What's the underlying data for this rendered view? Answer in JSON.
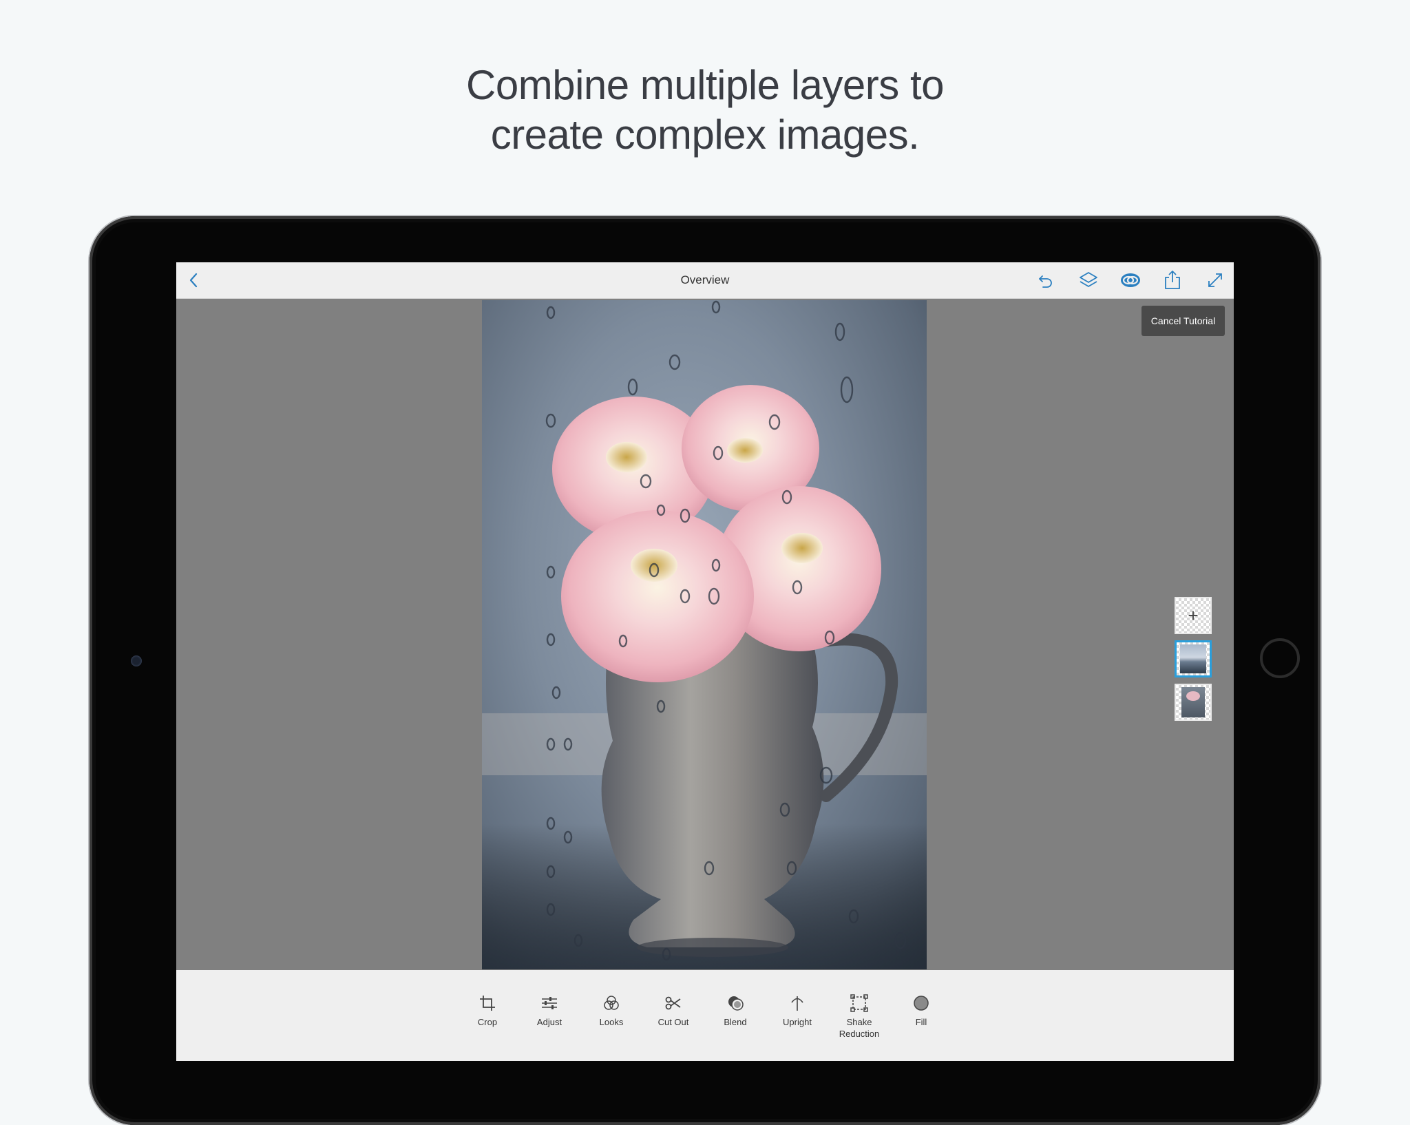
{
  "headline": {
    "line1": "Combine multiple layers to",
    "line2": "create complex images."
  },
  "app": {
    "title": "Overview",
    "cancel_tutorial": "Cancel Tutorial",
    "top_icons": [
      "back-icon",
      "undo-icon",
      "layers-icon",
      "creative-cloud-icon",
      "share-icon",
      "fullscreen-icon"
    ],
    "accent_color": "#2a9fdc"
  },
  "layers": {
    "add_symbol": "+",
    "items": [
      "Layer 1",
      "Layer 2"
    ],
    "selected_index": 0
  },
  "tools": [
    {
      "label": "Crop",
      "icon": "crop-icon"
    },
    {
      "label": "Adjust",
      "icon": "adjust-icon"
    },
    {
      "label": "Looks",
      "icon": "looks-icon"
    },
    {
      "label": "Cut Out",
      "icon": "cut-out-icon"
    },
    {
      "label": "Blend",
      "icon": "blend-icon"
    },
    {
      "label": "Upright",
      "icon": "upright-icon"
    },
    {
      "label": "Shake Reduction",
      "icon": "shake-reduction-icon"
    },
    {
      "label": "Fill",
      "icon": "fill-icon"
    }
  ]
}
